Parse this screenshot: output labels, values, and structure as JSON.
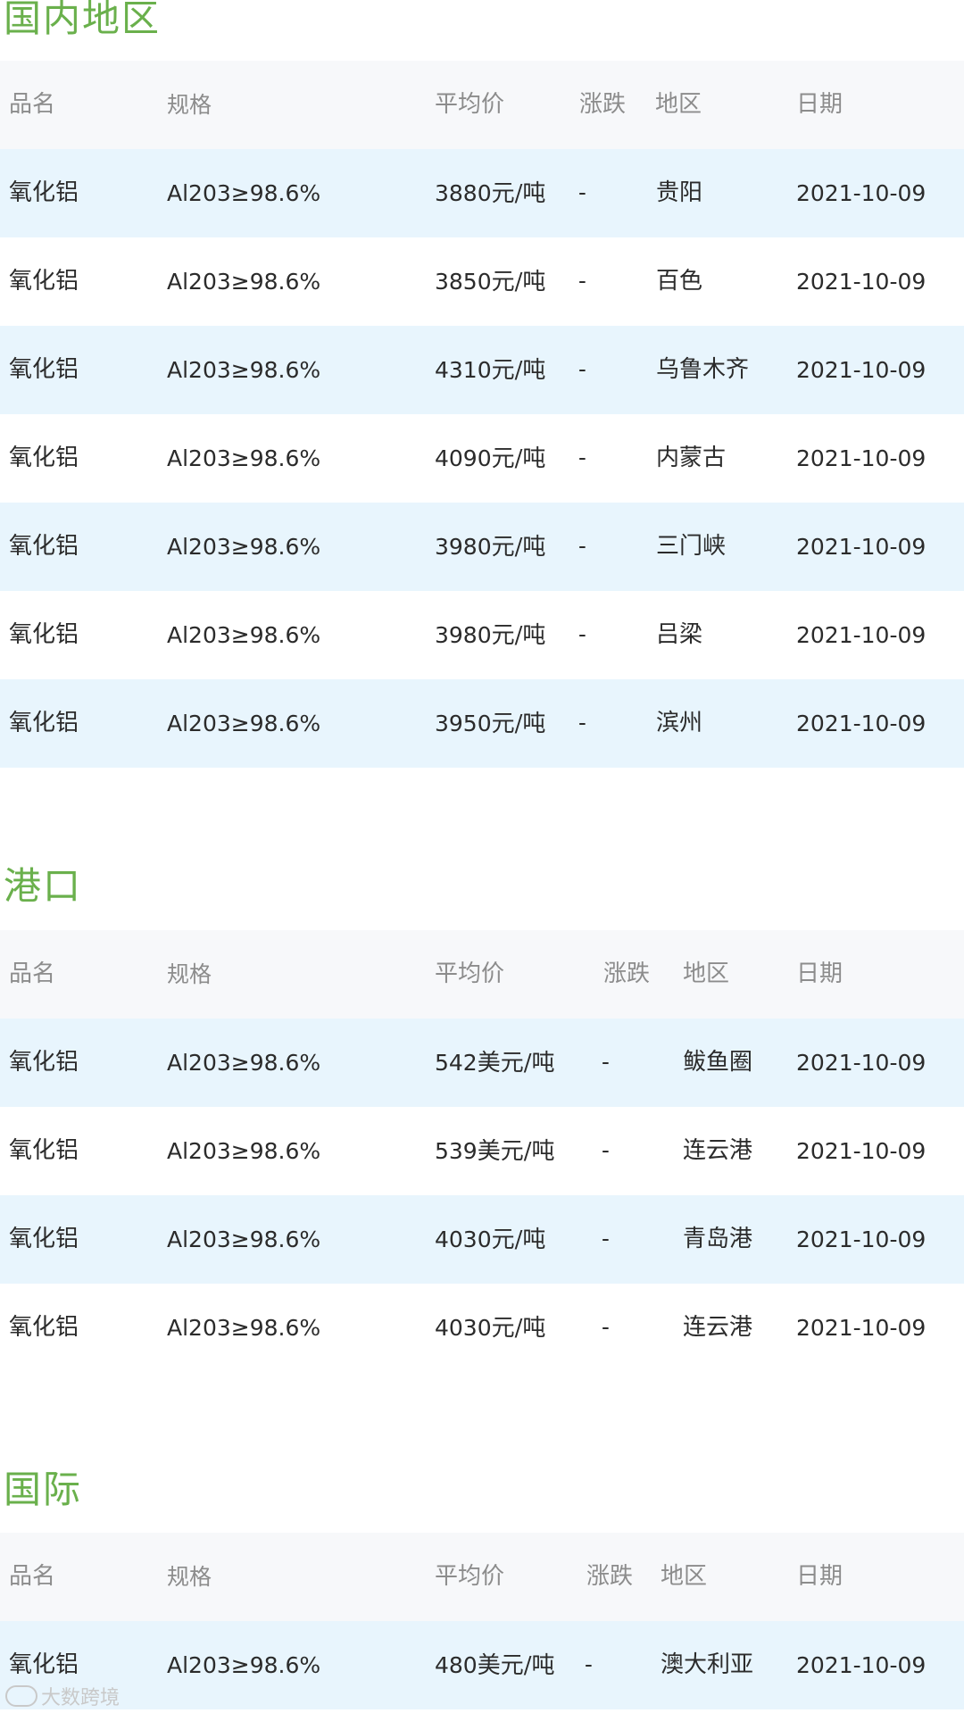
{
  "sections": [
    {
      "title": "国内地区",
      "headers": {
        "name": "品名",
        "spec": "规格",
        "price": "平均价",
        "change": "涨跌",
        "region": "地区",
        "date": "日期"
      },
      "rows": [
        {
          "name": "氧化铝",
          "spec": "Al203≥98.6%",
          "price_num": "3880",
          "price_unit": "元/吨",
          "change": "-",
          "region": "贵阳",
          "date": "2021-10-09"
        },
        {
          "name": "氧化铝",
          "spec": "Al203≥98.6%",
          "price_num": "3850",
          "price_unit": "元/吨",
          "change": "-",
          "region": "百色",
          "date": "2021-10-09"
        },
        {
          "name": "氧化铝",
          "spec": "Al203≥98.6%",
          "price_num": "4310",
          "price_unit": "元/吨",
          "change": "-",
          "region": "乌鲁木齐",
          "date": "2021-10-09"
        },
        {
          "name": "氧化铝",
          "spec": "Al203≥98.6%",
          "price_num": "4090",
          "price_unit": "元/吨",
          "change": "-",
          "region": "内蒙古",
          "date": "2021-10-09"
        },
        {
          "name": "氧化铝",
          "spec": "Al203≥98.6%",
          "price_num": "3980",
          "price_unit": "元/吨",
          "change": "-",
          "region": "三门峡",
          "date": "2021-10-09"
        },
        {
          "name": "氧化铝",
          "spec": "Al203≥98.6%",
          "price_num": "3980",
          "price_unit": "元/吨",
          "change": "-",
          "region": "吕梁",
          "date": "2021-10-09"
        },
        {
          "name": "氧化铝",
          "spec": "Al203≥98.6%",
          "price_num": "3950",
          "price_unit": "元/吨",
          "change": "-",
          "region": "滨州",
          "date": "2021-10-09"
        }
      ]
    },
    {
      "title": "港口",
      "headers": {
        "name": "品名",
        "spec": "规格",
        "price": "平均价",
        "change": "涨跌",
        "region": "地区",
        "date": "日期"
      },
      "rows": [
        {
          "name": "氧化铝",
          "spec": "Al203≥98.6%",
          "price_num": "542",
          "price_unit": "美元/吨",
          "change": "-",
          "region": "鲅鱼圈",
          "date": "2021-10-09"
        },
        {
          "name": "氧化铝",
          "spec": "Al203≥98.6%",
          "price_num": "539",
          "price_unit": "美元/吨",
          "change": "-",
          "region": "连云港",
          "date": "2021-10-09"
        },
        {
          "name": "氧化铝",
          "spec": "Al203≥98.6%",
          "price_num": "4030",
          "price_unit": "元/吨",
          "change": "-",
          "region": "青岛港",
          "date": "2021-10-09"
        },
        {
          "name": "氧化铝",
          "spec": "Al203≥98.6%",
          "price_num": "4030",
          "price_unit": "元/吨",
          "change": "-",
          "region": "连云港",
          "date": "2021-10-09"
        }
      ]
    },
    {
      "title": "国际",
      "headers": {
        "name": "品名",
        "spec": "规格",
        "price": "平均价",
        "change": "涨跌",
        "region": "地区",
        "date": "日期"
      },
      "rows": [
        {
          "name": "氧化铝",
          "spec": "Al203≥98.6%",
          "price_num": "480",
          "price_unit": "美元/吨",
          "change": "-",
          "region": "澳大利亚",
          "date": "2021-10-09"
        }
      ]
    }
  ],
  "watermark": {
    "text": "大数跨境"
  },
  "colors": {
    "title": "#6ab04c",
    "header_bg": "#f7f8fa",
    "stripe_bg": "#e8f5fd"
  }
}
